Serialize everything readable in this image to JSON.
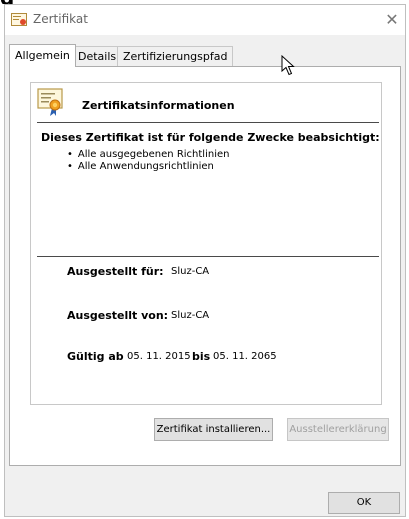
{
  "window": {
    "title": "Zertifikat",
    "close_glyph": "✕",
    "app_icon": "certificate-icon",
    "cropped_heading": "g"
  },
  "tabs": [
    {
      "label": "Allgemein",
      "active": true
    },
    {
      "label": "Details",
      "active": false
    },
    {
      "label": "Zertifizierungspfad",
      "active": false
    }
  ],
  "info": {
    "heading": "Zertifikatsinformationen",
    "icon": "certificate-icon",
    "purpose_heading": "Dieses Zertifikat ist für folgende Zwecke beabsichtigt:",
    "purposes": [
      "Alle ausgegebenen Richtlinien",
      "Alle Anwendungsrichtlinien"
    ],
    "issued_to_label": "Ausgestellt für:",
    "issued_to": "Sluz-CA",
    "issued_by_label": "Ausgestellt von:",
    "issued_by": "Sluz-CA",
    "valid_from_label": "Gültig ab",
    "valid_from": "05. 11. 2015",
    "valid_to_label": "bis",
    "valid_to": "05. 11. 2065"
  },
  "buttons": {
    "install": "Zertifikat installieren...",
    "issuer_statement": "Ausstellererklärung",
    "ok": "OK"
  },
  "colors": {
    "window_bg": "#f0f0f0",
    "panel_bg": "#ffffff",
    "title_text": "#666666",
    "disabled_text": "#a0a0a0"
  }
}
